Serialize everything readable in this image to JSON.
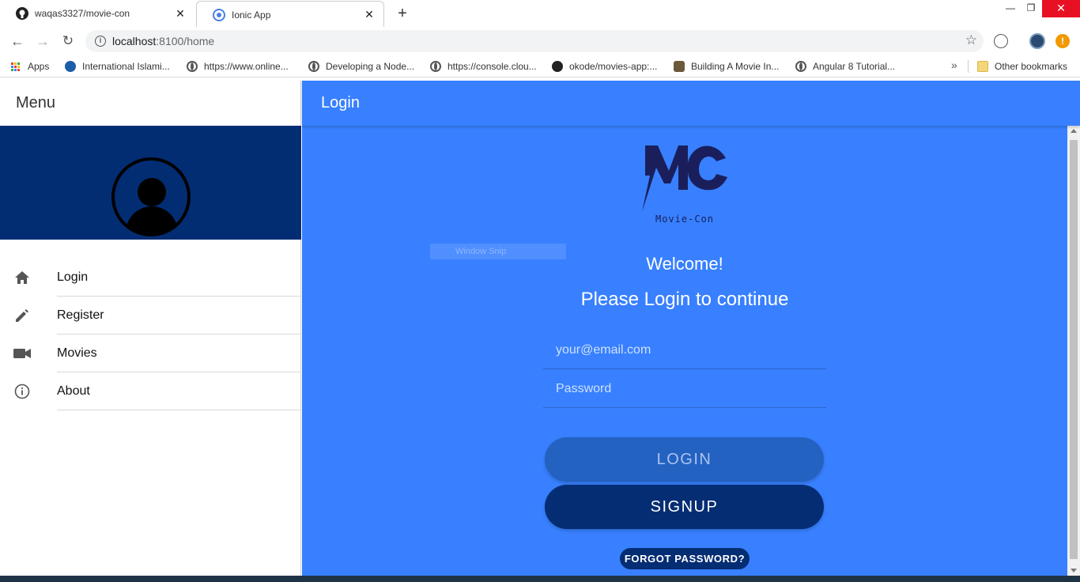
{
  "browser": {
    "tabs": [
      {
        "title": "waqas3327/movie-con",
        "icon": "github-icon"
      },
      {
        "title": "Ionic App",
        "icon": "chromium-icon"
      }
    ],
    "url_host": "localhost",
    "url_path": ":8100/home",
    "bookmarks": [
      {
        "label": "Apps",
        "icon": "apps-grid-icon"
      },
      {
        "label": "International Islami...",
        "icon": "oth-icon"
      },
      {
        "label": "https://www.online...",
        "icon": "globe-icon"
      },
      {
        "label": "Developing a Node...",
        "icon": "globe-icon"
      },
      {
        "label": "https://console.clou...",
        "icon": "globe-icon"
      },
      {
        "label": "okode/movies-app:...",
        "icon": "github-icon"
      },
      {
        "label": "Building A Movie In...",
        "icon": "movie-icon"
      },
      {
        "label": "Angular 8 Tutorial...",
        "icon": "globe-icon"
      }
    ],
    "other_bookmarks": "Other bookmarks"
  },
  "sidemenu": {
    "title": "Menu",
    "items": [
      {
        "label": "Login",
        "icon": "home-icon"
      },
      {
        "label": "Register",
        "icon": "pencil-icon"
      },
      {
        "label": "Movies",
        "icon": "videocam-icon"
      },
      {
        "label": "About",
        "icon": "info-icon"
      }
    ],
    "banner_color": "#032d73"
  },
  "page": {
    "title": "Login",
    "logo_text": "Movie-Con",
    "overlay_text": "Window Snip",
    "welcome": "Welcome!",
    "subtitle": "Please Login to continue",
    "email_placeholder": "your@email.com",
    "password_placeholder": "Password",
    "login_label": "LOGIN",
    "signup_label": "SIGNUP",
    "forgot_label": "FORGOT PASSWORD?",
    "primary_color": "#3880ff",
    "dark_color": "#052d73"
  }
}
